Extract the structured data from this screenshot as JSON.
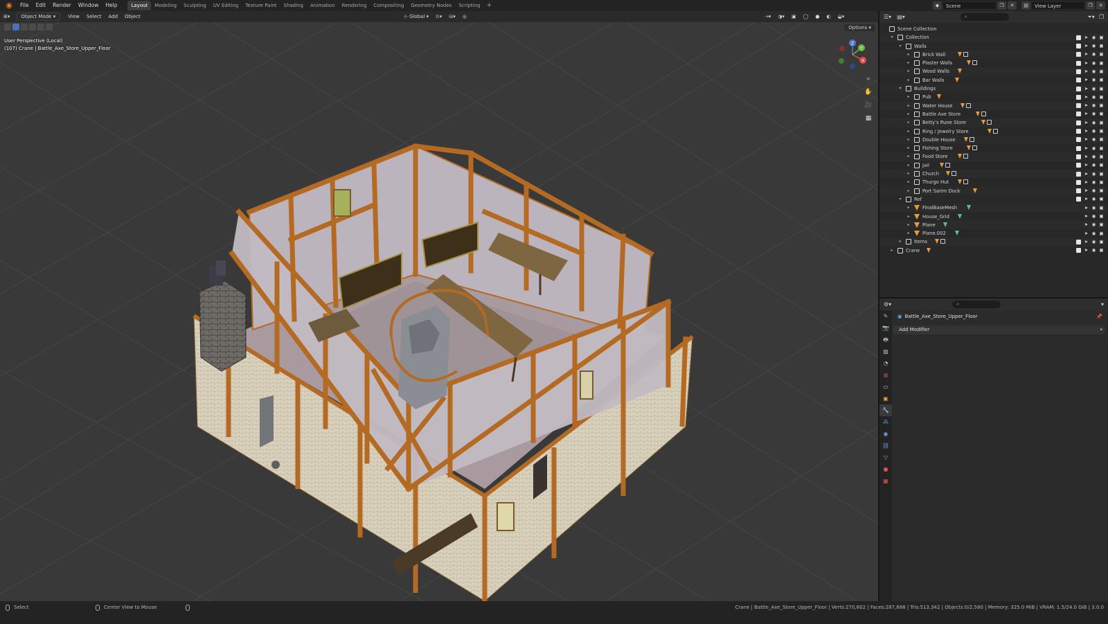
{
  "app": {
    "menus": [
      "File",
      "Edit",
      "Render",
      "Window",
      "Help"
    ],
    "workspaces": [
      "Layout",
      "Modeling",
      "Sculpting",
      "UV Editing",
      "Texture Paint",
      "Shading",
      "Animation",
      "Rendering",
      "Compositing",
      "Geometry Nodes",
      "Scripting"
    ],
    "active_workspace": "Layout",
    "scene_name": "Scene",
    "view_layer": "View Layer"
  },
  "viewport": {
    "mode": "Object Mode",
    "menus": [
      "View",
      "Select",
      "Add",
      "Object"
    ],
    "transform_orientation": "Global",
    "options_label": "Options",
    "info_line1": "User Perspective (Local)",
    "info_line2": "(107) Crane | Battle_Axe_Store_Upper_Floor",
    "gizmo": {
      "x": "X",
      "y": "Y",
      "z": "Z"
    }
  },
  "outliner": {
    "root": "Scene Collection",
    "rows": [
      {
        "label": "Collection",
        "depth": 1,
        "kind": "collection",
        "open": true
      },
      {
        "label": "Walls",
        "depth": 2,
        "kind": "collection",
        "open": true
      },
      {
        "label": "Brick Wall",
        "depth": 3,
        "kind": "collection",
        "extras": [
          "tri",
          "mat"
        ]
      },
      {
        "label": "Plaster Walls",
        "depth": 3,
        "kind": "collection",
        "extras": [
          "tri",
          "mat"
        ]
      },
      {
        "label": "Wood Walls",
        "depth": 3,
        "kind": "collection",
        "extras": [
          "tri"
        ]
      },
      {
        "label": "Bar Walls",
        "depth": 3,
        "kind": "collection",
        "extras": [
          "tri"
        ]
      },
      {
        "label": "Buildings",
        "depth": 2,
        "kind": "collection",
        "open": true
      },
      {
        "label": "Pub",
        "depth": 3,
        "kind": "collection",
        "extras": [
          "tri"
        ]
      },
      {
        "label": "Water House",
        "depth": 3,
        "kind": "collection",
        "extras": [
          "tri",
          "mat"
        ]
      },
      {
        "label": "Battle Axe Store",
        "depth": 3,
        "kind": "collection",
        "extras": [
          "tri",
          "mat"
        ]
      },
      {
        "label": "Betty's Rune Store",
        "depth": 3,
        "kind": "collection",
        "extras": [
          "tri",
          "mat"
        ]
      },
      {
        "label": "Ring / Jewelry Store",
        "depth": 3,
        "kind": "collection",
        "extras": [
          "tri",
          "mat"
        ]
      },
      {
        "label": "Double House",
        "depth": 3,
        "kind": "collection",
        "extras": [
          "tri",
          "mat"
        ]
      },
      {
        "label": "Fishing Store",
        "depth": 3,
        "kind": "collection",
        "extras": [
          "tri",
          "mat"
        ]
      },
      {
        "label": "Food Store",
        "depth": 3,
        "kind": "collection",
        "extras": [
          "tri",
          "mat"
        ]
      },
      {
        "label": "Jail",
        "depth": 3,
        "kind": "collection",
        "extras": [
          "tri",
          "mat"
        ]
      },
      {
        "label": "Church",
        "depth": 3,
        "kind": "collection",
        "extras": [
          "tri",
          "mat"
        ]
      },
      {
        "label": "Thurgo Hut",
        "depth": 3,
        "kind": "collection",
        "extras": [
          "tri",
          "mat"
        ]
      },
      {
        "label": "Port Sarim Dock",
        "depth": 3,
        "kind": "collection",
        "extras": [
          "tri"
        ]
      },
      {
        "label": "Ref",
        "depth": 2,
        "kind": "collection",
        "open": true
      },
      {
        "label": "FinalBaseMesh",
        "depth": 3,
        "kind": "mesh",
        "extras": [
          "green"
        ]
      },
      {
        "label": "House_Grid",
        "depth": 3,
        "kind": "mesh",
        "extras": [
          "green"
        ]
      },
      {
        "label": "Plane",
        "depth": 3,
        "kind": "mesh",
        "extras": [
          "green"
        ]
      },
      {
        "label": "Plane.002",
        "depth": 3,
        "kind": "mesh",
        "extras": [
          "green"
        ]
      },
      {
        "label": "Items",
        "depth": 2,
        "kind": "collection",
        "extras": [
          "tri",
          "mat"
        ]
      },
      {
        "label": "Crane",
        "depth": 1,
        "kind": "collection",
        "extras": [
          "tri"
        ]
      }
    ]
  },
  "properties": {
    "object_name": "Battle_Axe_Store_Upper_Floor",
    "add_modifier_label": "Add Modifier"
  },
  "statusbar": {
    "left": "Select",
    "middle": "Center View to Mouse",
    "right": "Crane | Battle_Axe_Store_Upper_Floor | Verts:270,602 | Faces:287,688 | Tris:513,342 | Objects:0/2,580 | Memory: 325.0 MiB | VRAM: 1.5/24.0 GiB | 3.0.0"
  },
  "colors": {
    "accent": "#e87d0d",
    "timber": "#b46a22",
    "plaster": "#bcb4bc",
    "floor": "#a99aa0",
    "brick": "#d9d1bc",
    "grid_bg": "#393939"
  }
}
